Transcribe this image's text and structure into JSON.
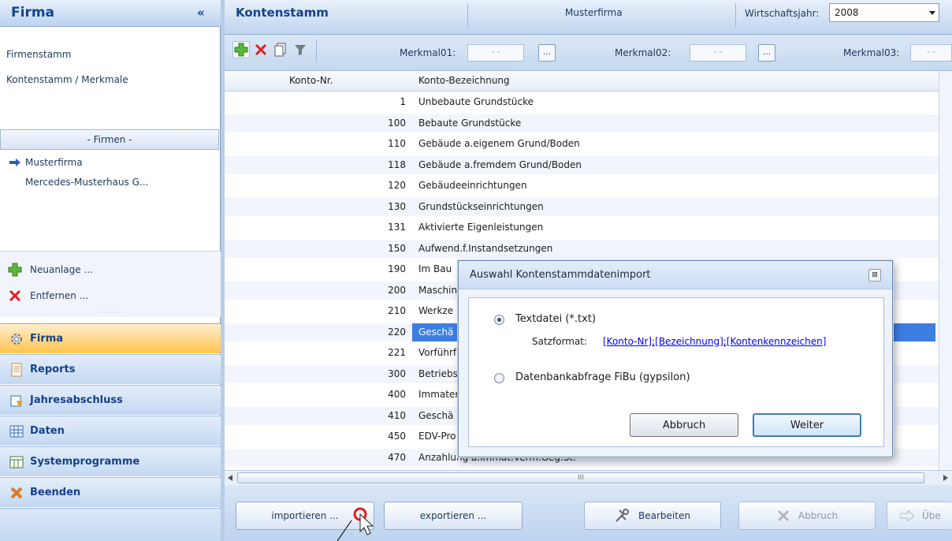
{
  "left_panel": {
    "title": "Firma",
    "collapse_symbol": "«",
    "links": [
      "Firmenstamm",
      "Kontenstamm / Merkmale"
    ],
    "firms_group_label": "- Firmen -",
    "firms": [
      "Musterfirma",
      "Mercedes-Musterhaus G..."
    ],
    "actions": [
      {
        "label": "Neuanlage ...",
        "icon": "add-icon"
      },
      {
        "label": "Entfernen ...",
        "icon": "delete-icon"
      }
    ],
    "nav": [
      {
        "label": "Firma",
        "icon": "gear-icon",
        "active": true
      },
      {
        "label": "Reports",
        "icon": "report-icon",
        "active": false
      },
      {
        "label": "Jahresabschluss",
        "icon": "year-end-icon",
        "active": false
      },
      {
        "label": "Daten",
        "icon": "data-icon",
        "active": false
      },
      {
        "label": "Systemprogramme",
        "icon": "system-icon",
        "active": false
      },
      {
        "label": "Beenden",
        "icon": "exit-icon",
        "active": false
      }
    ]
  },
  "header": {
    "title": "Kontenstamm",
    "company": "Musterfirma",
    "fiscal_year_label": "Wirtschaftsjahr:",
    "fiscal_year_value": "2008"
  },
  "toolbar": {
    "merkmal1_label": "Merkmal01:",
    "merkmal2_label": "Merkmal02:",
    "merkmal3_label": "Merkmal03:",
    "field_placeholder": "- -",
    "browse_label": "..."
  },
  "table": {
    "columns": [
      "Konto-Nr.",
      "Konto-Bezeichnung"
    ],
    "rows": [
      {
        "nr": "1",
        "name": "Unbebaute Grundstücke"
      },
      {
        "nr": "100",
        "name": "Bebaute Grundstücke"
      },
      {
        "nr": "110",
        "name": "Gebäude a.eigenem Grund/Boden"
      },
      {
        "nr": "118",
        "name": "Gebäude a.fremdem Grund/Boden"
      },
      {
        "nr": "120",
        "name": "Gebäudeeinrichtungen"
      },
      {
        "nr": "130",
        "name": "Grundstückseinrichtungen"
      },
      {
        "nr": "131",
        "name": "Aktivierte Eigenleistungen"
      },
      {
        "nr": "150",
        "name": "Aufwend.f.Instandsetzungen"
      },
      {
        "nr": "190",
        "name": "Im Bau"
      },
      {
        "nr": "200",
        "name": "Maschin"
      },
      {
        "nr": "210",
        "name": "Werkze"
      },
      {
        "nr": "220",
        "name": "Geschä"
      },
      {
        "nr": "221",
        "name": "Vorführf"
      },
      {
        "nr": "300",
        "name": "Betriebs"
      },
      {
        "nr": "400",
        "name": "Immater"
      },
      {
        "nr": "410",
        "name": "Geschä"
      },
      {
        "nr": "450",
        "name": "EDV-Pro"
      },
      {
        "nr": "470",
        "name": "Anzahlung a.immat.Verm.Geg.St."
      }
    ],
    "selected_row_index": 11,
    "hscroll_grip": "III"
  },
  "bottom": {
    "import_label": "importieren ...",
    "export_label": "exportieren ...",
    "edit_label": "Bearbeiten",
    "cancel_label": "Abbruch",
    "accept_label": "Übe"
  },
  "dialog": {
    "title": "Auswahl Kontenstammdatenimport",
    "close_symbol": "⊠",
    "option1_label": "Textdatei  (*.txt)",
    "format_label": "Satzformat:",
    "format_value": "[Konto-Nr];[Bezeichnung];[Kontenkennzeichen]",
    "option2_label": "Datenbankabfrage FiBu (gypsilon)",
    "cancel_label": "Abbruch",
    "next_label": "Weiter"
  }
}
